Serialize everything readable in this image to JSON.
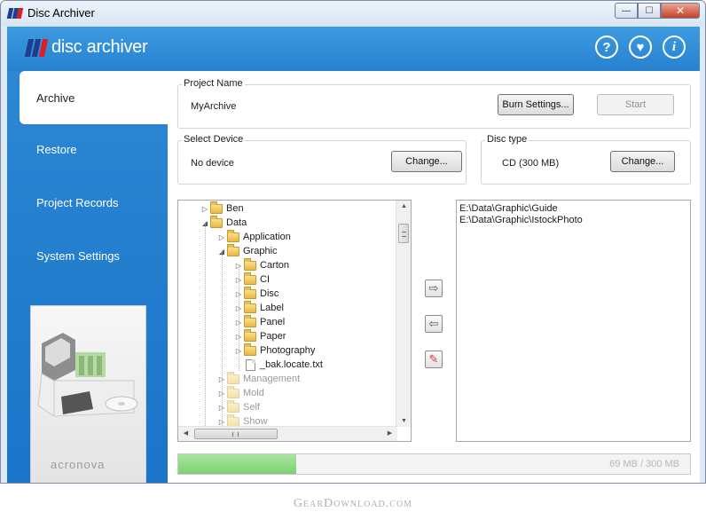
{
  "window": {
    "title": "Disc Archiver",
    "controls": {
      "minimize": "—",
      "maximize": "☐",
      "close": "✕"
    }
  },
  "header": {
    "brand": "disc archiver",
    "brand_colors": [
      "#e31b23",
      "#1a3f91",
      "#1a3f91"
    ],
    "icons": [
      {
        "name": "help-icon",
        "glyph": "?"
      },
      {
        "name": "heart-icon",
        "glyph": "♥"
      },
      {
        "name": "info-icon",
        "glyph": "i"
      }
    ]
  },
  "sidebar": {
    "items": [
      {
        "label": "Archive",
        "active": true
      },
      {
        "label": "Restore",
        "active": false
      },
      {
        "label": "Project Records",
        "active": false
      },
      {
        "label": "System Settings",
        "active": false
      }
    ],
    "promo_brand": "acronova"
  },
  "project": {
    "group_label": "Project Name",
    "name": "MyArchive",
    "burn_settings_label": "Burn Settings...",
    "start_label": "Start"
  },
  "device": {
    "group_label": "Select Device",
    "value": "No device",
    "change_label": "Change..."
  },
  "disc": {
    "group_label": "Disc type",
    "value": "CD (300 MB)",
    "change_label": "Change..."
  },
  "tree": {
    "rows": [
      {
        "label": "Ben",
        "expander": "▷",
        "type": "folder",
        "dim": false
      },
      {
        "label": "Data",
        "expander": "◢",
        "type": "folder",
        "dim": false
      },
      {
        "label": "Application",
        "expander": "▷",
        "type": "folder",
        "dim": false
      },
      {
        "label": "Graphic",
        "expander": "◢",
        "type": "folder",
        "dim": false
      },
      {
        "label": "Carton",
        "expander": "▷",
        "type": "folder",
        "dim": false
      },
      {
        "label": "CI",
        "expander": "▷",
        "type": "folder",
        "dim": false
      },
      {
        "label": "Disc",
        "expander": "▷",
        "type": "folder",
        "dim": false
      },
      {
        "label": "Label",
        "expander": "▷",
        "type": "folder",
        "dim": false
      },
      {
        "label": "Panel",
        "expander": "▷",
        "type": "folder",
        "dim": false
      },
      {
        "label": "Paper",
        "expander": "▷",
        "type": "folder",
        "dim": false
      },
      {
        "label": "Photography",
        "expander": "▷",
        "type": "folder",
        "dim": false
      },
      {
        "label": "_bak.locate.txt",
        "expander": "",
        "type": "file",
        "dim": false
      },
      {
        "label": "Management",
        "expander": "▷",
        "type": "folder",
        "dim": true
      },
      {
        "label": "Mold",
        "expander": "▷",
        "type": "folder",
        "dim": true
      },
      {
        "label": "Self",
        "expander": "▷",
        "type": "folder",
        "dim": true
      },
      {
        "label": "Show",
        "expander": "▷",
        "type": "folder",
        "dim": true
      }
    ]
  },
  "transfer": {
    "add_glyph": "⇨",
    "remove_glyph": "⇦",
    "clear_glyph": "✎"
  },
  "selected": {
    "items": [
      "E:\\Data\\Graphic\\Guide",
      "E:\\Data\\Graphic\\IstockPhoto"
    ]
  },
  "capacity": {
    "text": "69 MB / 300 MB",
    "used_fraction": 0.23,
    "fill_color": "#7dd072"
  },
  "footer": {
    "watermark": "GearDownload.com"
  }
}
